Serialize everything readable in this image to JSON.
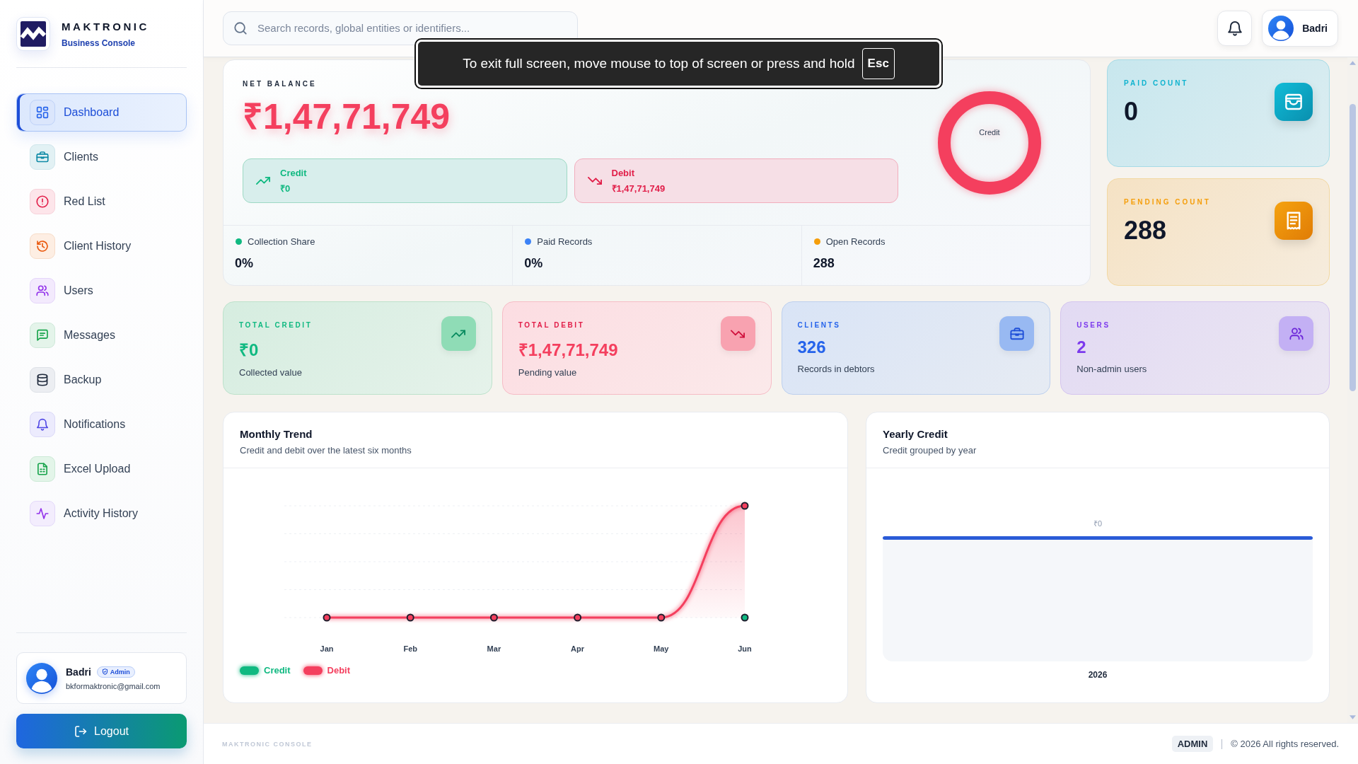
{
  "sidebar": {
    "brand": {
      "name": "MAKTRONIC",
      "subtitle": "Business Console"
    },
    "nav": [
      {
        "label": "Dashboard",
        "selected": true
      },
      {
        "label": "Clients",
        "selected": false
      },
      {
        "label": "Red List",
        "selected": false
      },
      {
        "label": "Client History",
        "selected": false
      },
      {
        "label": "Users",
        "selected": false
      },
      {
        "label": "Messages",
        "selected": false
      },
      {
        "label": "Backup",
        "selected": false
      },
      {
        "label": "Notifications",
        "selected": false
      },
      {
        "label": "Excel Upload",
        "selected": false
      },
      {
        "label": "Activity History",
        "selected": false
      }
    ],
    "profile": {
      "name": "Badri",
      "role": "Admin",
      "email": "bkformaktronic@gmail.com"
    },
    "logout": "Logout"
  },
  "header": {
    "search": {
      "placeholder": "Search records, global entities or identifiers..."
    },
    "user": "Badri"
  },
  "fullscreen_notice": {
    "message": "To exit full screen, move mouse to top of screen or press and hold",
    "key": "Esc"
  },
  "net_balance": {
    "label": "NET BALANCE",
    "amount": "₹1,47,71,749",
    "breakdown": [
      {
        "label": "Credit",
        "amount": "₹0"
      },
      {
        "label": "Debit",
        "amount": "₹1,47,71,749"
      }
    ],
    "ring": {
      "label": "Credit"
    },
    "metrics": [
      {
        "label": "Collection Share",
        "value": "0%",
        "color": "#10b981"
      },
      {
        "label": "Paid Records",
        "value": "0%",
        "color": "#3b82f6"
      },
      {
        "label": "Open Records",
        "value": "288",
        "color": "#f59e0b"
      }
    ]
  },
  "count_cards": [
    {
      "label": "PAID COUNT",
      "value": "0"
    },
    {
      "label": "PENDING COUNT",
      "value": "288"
    }
  ],
  "stat_cards": [
    {
      "label": "TOTAL CREDIT",
      "value": "₹0",
      "caption": "Collected value"
    },
    {
      "label": "TOTAL DEBIT",
      "value": "₹1,47,71,749",
      "caption": "Pending value"
    },
    {
      "label": "CLIENTS",
      "value": "326",
      "caption": "Records in debtors"
    },
    {
      "label": "USERS",
      "value": "2",
      "caption": "Non-admin users"
    }
  ],
  "monthly_trend": {
    "title": "Monthly Trend",
    "subtitle": "Credit and debit over the latest six months",
    "months": [
      "Jan",
      "Feb",
      "Mar",
      "Apr",
      "May",
      "Jun"
    ],
    "legend": [
      {
        "name": "Credit",
        "color": "#10b981"
      },
      {
        "name": "Debit",
        "color": "#f43f5e"
      }
    ]
  },
  "yearly_credit": {
    "title": "Yearly Credit",
    "subtitle": "Credit grouped by year",
    "bars": [
      {
        "category": "2026",
        "value_label": "₹0"
      }
    ]
  },
  "footer": {
    "brand": "MAKTRONIC CONSOLE",
    "role": "ADMIN",
    "copyright": "© 2026 All rights reserved."
  }
}
